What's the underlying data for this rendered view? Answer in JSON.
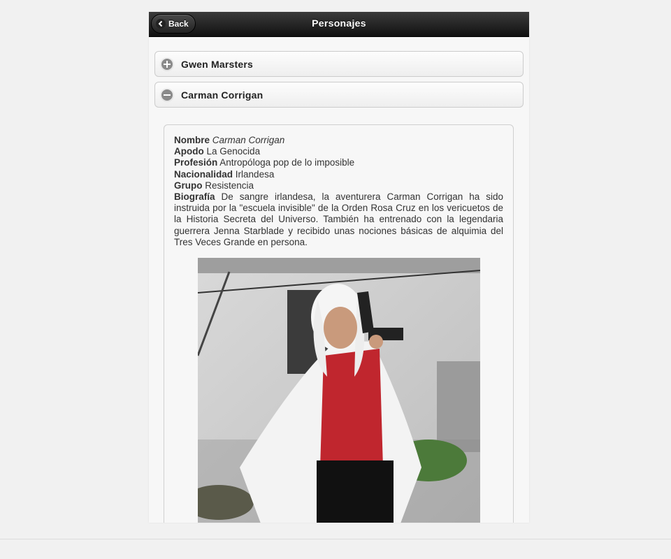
{
  "header": {
    "back_label": "Back",
    "title": "Personajes"
  },
  "collapsibles": [
    {
      "label": "Gwen Marsters",
      "state": "collapsed",
      "icon": "plus-icon"
    },
    {
      "label": "Carman Corrigan",
      "state": "expanded",
      "icon": "minus-icon"
    }
  ],
  "character": {
    "nombre_label": "Nombre",
    "nombre": "Carman Corrigan",
    "apodo_label": "Apodo",
    "apodo": "La Genocida",
    "profesion_label": "Profesión",
    "profesion": "Antropóloga pop de lo imposible",
    "nacionalidad_label": "Nacionalidad",
    "nacionalidad": "Irlandesa",
    "grupo_label": "Grupo",
    "grupo": "Resistencia",
    "biografia_label": "Biografía",
    "biografia": "De sangre irlandesa, la aventurera Carman Corrigan ha sido instruida por la \"escuela invisible\" de la Orden Rosa Cruz en los vericuetos de la Historia Secreta del Universo. También ha entrenado con la legendaria guerrera Jenna Starblade y recibido unas nociones básicas de alquimia del Tres Veces Grande en persona."
  },
  "colors": {
    "header_dark": "#1a1a1a",
    "icon_gray": "#8a8a8a",
    "page_bg": "#f1f1f1"
  }
}
